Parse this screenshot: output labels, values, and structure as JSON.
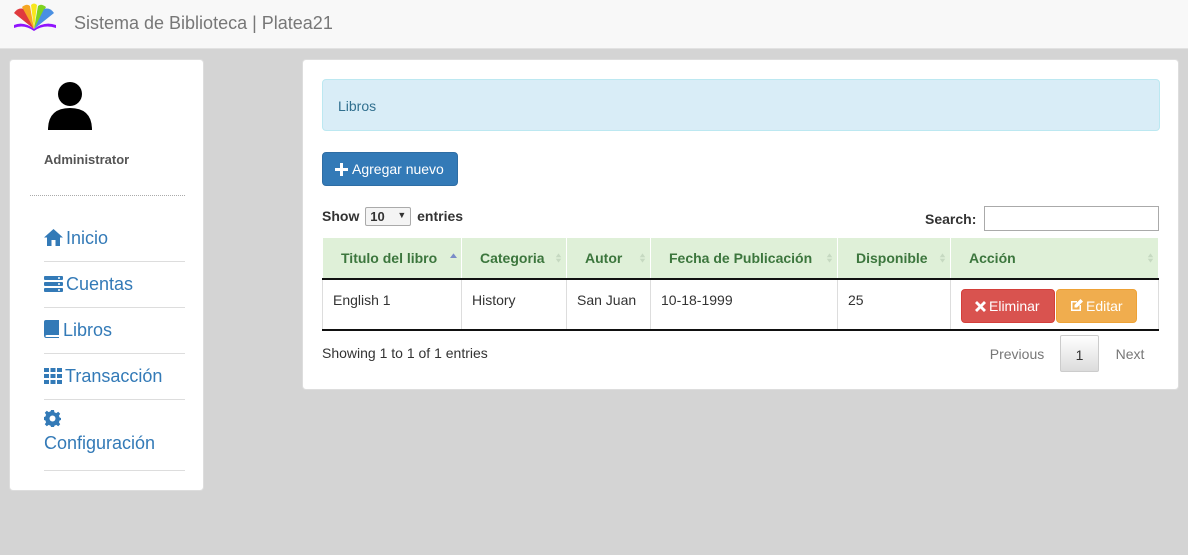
{
  "app": {
    "title": "Sistema de Biblioteca | Platea21",
    "logo_colors": [
      "#e03a3e",
      "#f5a623",
      "#f8e71c",
      "#7ed321",
      "#4a90e2",
      "#9013fe"
    ]
  },
  "sidebar": {
    "role": "Administrator",
    "items": [
      {
        "label": "Inicio",
        "icon": "home-icon"
      },
      {
        "label": "Cuentas",
        "icon": "server-icon"
      },
      {
        "label": "Libros",
        "icon": "book-icon"
      },
      {
        "label": "Transacción",
        "icon": "grid-icon"
      },
      {
        "label": "Configuración",
        "icon": "gear-icon"
      }
    ]
  },
  "main": {
    "panel_title": "Libros",
    "add_button": "Agregar nuevo",
    "length": {
      "show": "Show",
      "value": "10",
      "entries": "entries"
    },
    "search_label": "Search:",
    "search_value": "",
    "table": {
      "columns": [
        "Titulo del libro",
        "Categoria",
        "Autor",
        "Fecha de Publicación",
        "Disponible",
        "Acción"
      ],
      "rows": [
        {
          "titulo": "English 1",
          "categoria": "History",
          "autor": "San Juan",
          "fecha": "10-18-1999",
          "disponible": "25"
        }
      ],
      "delete_label": "Eliminar",
      "edit_label": "Editar"
    },
    "info": "Showing 1 to 1 of 1 entries",
    "pagination": {
      "previous": "Previous",
      "current": "1",
      "next": "Next"
    }
  },
  "colors": {
    "primary": "#337ab7",
    "danger": "#d9534f",
    "warning": "#f0ad4e",
    "header_green": "#dff0d8",
    "alert_info": "#d9edf7"
  }
}
